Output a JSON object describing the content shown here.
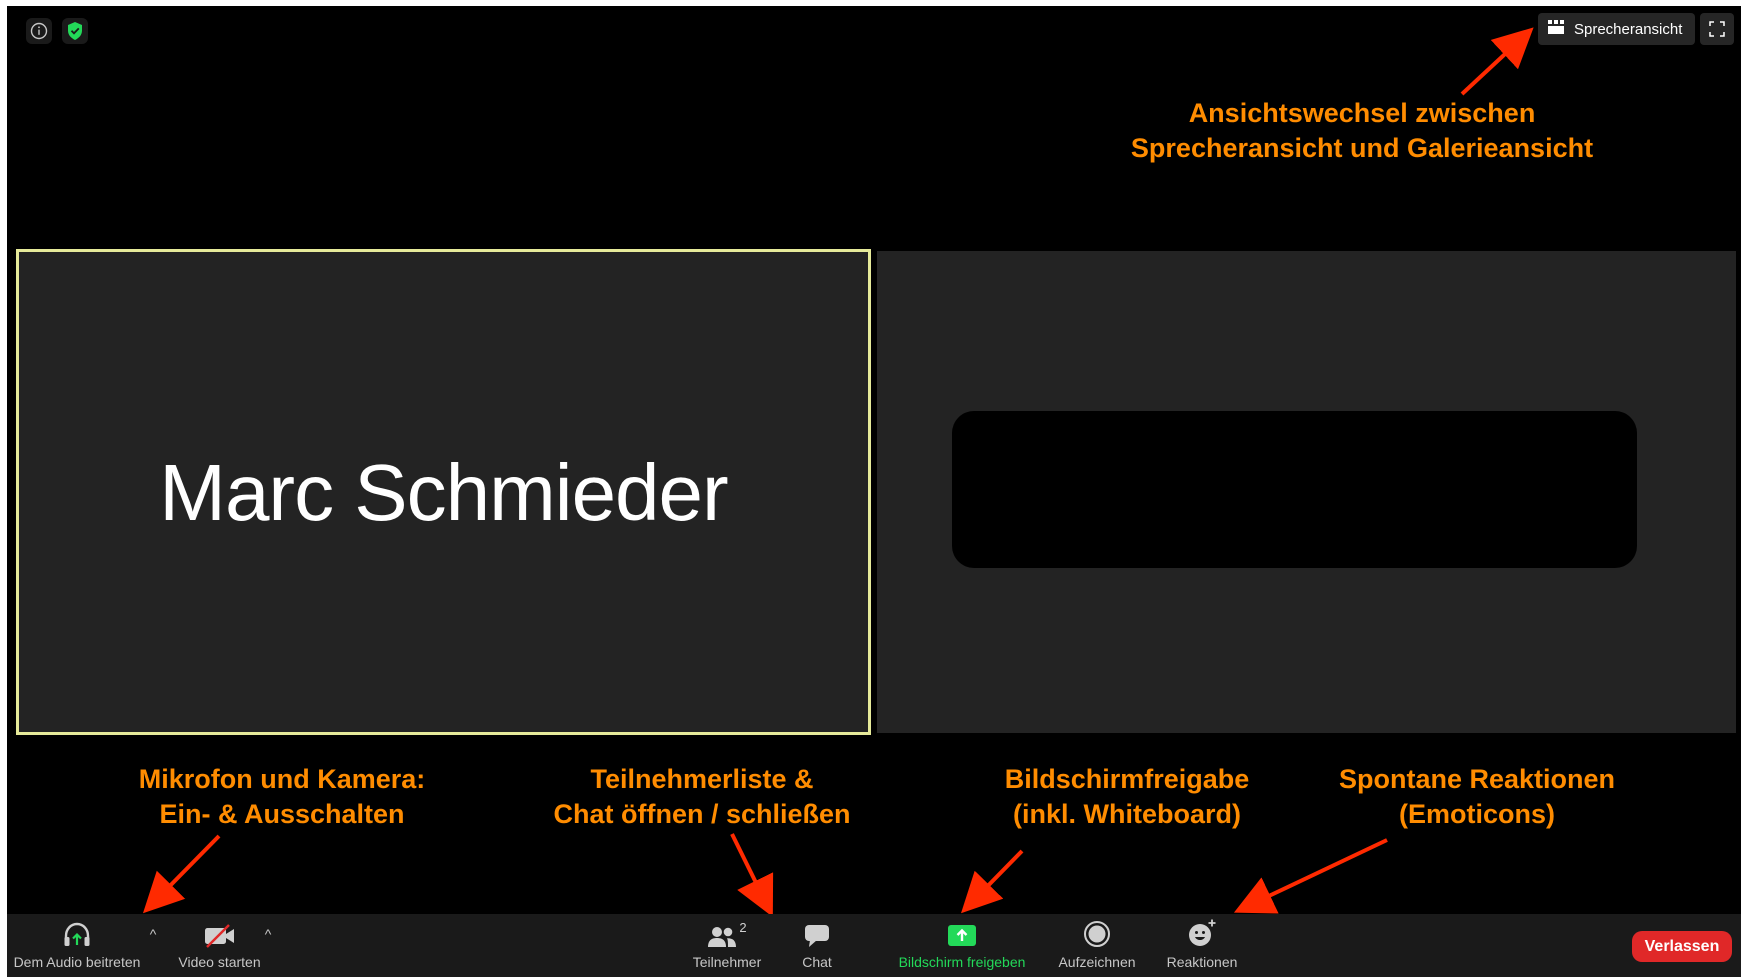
{
  "top_bar": {
    "info_icon": "info-icon",
    "security_icon": "shield-check-icon",
    "security_color": "#23d959",
    "view_switch_label": "Sprecheransicht",
    "view_switch_icon": "gallery-grid-icon",
    "fullscreen_icon": "fullscreen-icon"
  },
  "annotations": {
    "view_switch": [
      "Ansichtswechsel zwischen",
      "Sprecheransicht und Galerieansicht"
    ],
    "mic_camera": [
      "Mikrofon und Kamera:",
      "Ein- & Ausschalten"
    ],
    "participants_chat": [
      "Teilnehmerliste &",
      "Chat öffnen / schließen"
    ],
    "screen_share": [
      "Bildschirmfreigabe",
      "(inkl. Whiteboard)"
    ],
    "reactions": [
      "Spontane Reaktionen",
      "(Emoticons)"
    ],
    "color": "#ff8c00",
    "arrow_color": "#ff2a00"
  },
  "tiles": {
    "active_speaker_name": "Marc Schmieder",
    "active_border_color": "#e6ea9a"
  },
  "toolbar": {
    "audio_label": "Dem Audio beitreten",
    "video_label": "Video starten",
    "participants_label": "Teilnehmer",
    "participants_count": "2",
    "chat_label": "Chat",
    "share_label": "Bildschirm freigeben",
    "record_label": "Aufzeichnen",
    "reactions_label": "Reaktionen",
    "leave_label": "Verlassen",
    "share_color": "#23d959",
    "leave_color": "#e02828"
  }
}
